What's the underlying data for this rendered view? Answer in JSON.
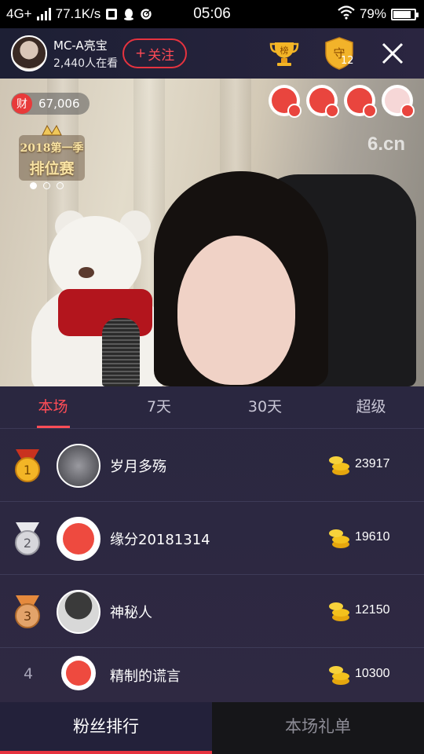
{
  "status_bar": {
    "network": "4G+",
    "speed": "77.1K/s",
    "time": "05:06",
    "battery": "79%",
    "battery_level": 0.79
  },
  "header": {
    "host_name": "MC-A亮宝",
    "viewers": "2,440人在看",
    "follow_label": "关注",
    "trophy_label": "榜",
    "guard_label": "守",
    "guard_count": "12",
    "accent": "#e6333f"
  },
  "video": {
    "wealth_icon": "财",
    "wealth_value": "67,006",
    "event_line1": "2018第一季",
    "event_line2": "排位赛",
    "watermark": "6.cn",
    "carousel_active": 0,
    "carousel_count": 3
  },
  "tabs": [
    "本场",
    "7天",
    "30天",
    "超级"
  ],
  "ranking": [
    {
      "rank": "1",
      "name": "岁月多殇",
      "score": "23917",
      "medal": "gold"
    },
    {
      "rank": "2",
      "name": "缘分20181314",
      "score": "19610",
      "medal": "silver"
    },
    {
      "rank": "3",
      "name": "神秘人",
      "score": "12150",
      "medal": "bronze"
    },
    {
      "rank": "4",
      "name": "精制的谎言",
      "score": "10300",
      "medal": "none"
    }
  ],
  "bottom_tabs": {
    "fans": "粉丝排行",
    "gifts": "本场礼单"
  }
}
